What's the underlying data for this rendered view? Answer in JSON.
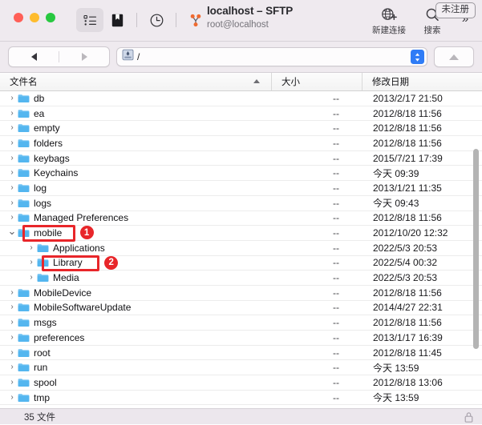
{
  "window": {
    "title": "localhost – SFTP",
    "subtitle": "root@localhost",
    "unregistered_badge": "未注册",
    "accent_color": "#2f7cf6",
    "annotation_color": "#e8262a"
  },
  "toolbar": {
    "left_buttons": [
      {
        "name": "list-view-icon",
        "label": ""
      },
      {
        "name": "bookmark-icon",
        "label": ""
      },
      {
        "name": "history-clock-icon",
        "label": ""
      },
      {
        "name": "share-nodes-icon",
        "label": ""
      }
    ],
    "right_items": [
      {
        "name": "new-connection-icon",
        "label": "新建连接"
      },
      {
        "name": "search-icon",
        "label": "搜索"
      }
    ],
    "overflow_label": "»"
  },
  "navbar": {
    "back_label": "◀",
    "forward_label": "▶",
    "path_value": "/",
    "path_placeholder": "/",
    "up_label": "▲"
  },
  "columns": {
    "name": "文件名",
    "size": "大小",
    "date": "修改日期",
    "sort_direction": "ascending"
  },
  "rows": [
    {
      "name": "db",
      "size": "--",
      "date": "2013/2/17 21:50",
      "depth": 0,
      "expanded": false
    },
    {
      "name": "ea",
      "size": "--",
      "date": "2012/8/18 11:56",
      "depth": 0,
      "expanded": false
    },
    {
      "name": "empty",
      "size": "--",
      "date": "2012/8/18 11:56",
      "depth": 0,
      "expanded": false
    },
    {
      "name": "folders",
      "size": "--",
      "date": "2012/8/18 11:56",
      "depth": 0,
      "expanded": false
    },
    {
      "name": "keybags",
      "size": "--",
      "date": "2015/7/21 17:39",
      "depth": 0,
      "expanded": false
    },
    {
      "name": "Keychains",
      "size": "--",
      "date": "今天 09:39",
      "depth": 0,
      "expanded": false
    },
    {
      "name": "log",
      "size": "--",
      "date": "2013/1/21 11:35",
      "depth": 0,
      "expanded": false
    },
    {
      "name": "logs",
      "size": "--",
      "date": "今天 09:43",
      "depth": 0,
      "expanded": false
    },
    {
      "name": "Managed Preferences",
      "size": "--",
      "date": "2012/8/18 11:56",
      "depth": 0,
      "expanded": false
    },
    {
      "name": "mobile",
      "size": "--",
      "date": "2012/10/20 12:32",
      "depth": 0,
      "expanded": true
    },
    {
      "name": "Applications",
      "size": "--",
      "date": "2022/5/3 20:53",
      "depth": 1,
      "expanded": false
    },
    {
      "name": "Library",
      "size": "--",
      "date": "2022/5/4 00:32",
      "depth": 1,
      "expanded": false
    },
    {
      "name": "Media",
      "size": "--",
      "date": "2022/5/3 20:53",
      "depth": 1,
      "expanded": false
    },
    {
      "name": "MobileDevice",
      "size": "--",
      "date": "2012/8/18 11:56",
      "depth": 0,
      "expanded": false
    },
    {
      "name": "MobileSoftwareUpdate",
      "size": "--",
      "date": "2014/4/27 22:31",
      "depth": 0,
      "expanded": false
    },
    {
      "name": "msgs",
      "size": "--",
      "date": "2012/8/18 11:56",
      "depth": 0,
      "expanded": false
    },
    {
      "name": "preferences",
      "size": "--",
      "date": "2013/1/17 16:39",
      "depth": 0,
      "expanded": false
    },
    {
      "name": "root",
      "size": "--",
      "date": "2012/8/18 11:45",
      "depth": 0,
      "expanded": false
    },
    {
      "name": "run",
      "size": "--",
      "date": "今天 13:59",
      "depth": 0,
      "expanded": false
    },
    {
      "name": "spool",
      "size": "--",
      "date": "2012/8/18 13:06",
      "depth": 0,
      "expanded": false
    },
    {
      "name": "tmp",
      "size": "--",
      "date": "今天 13:59",
      "depth": 0,
      "expanded": false
    }
  ],
  "annotations": [
    {
      "number": "1",
      "target": "mobile"
    },
    {
      "number": "2",
      "target": "Library"
    }
  ],
  "statusbar": {
    "text": "35 文件",
    "lock_icon": "lock-icon"
  }
}
